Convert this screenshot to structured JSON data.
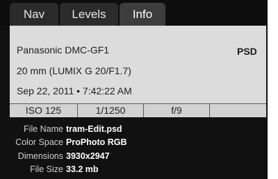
{
  "tabs": [
    {
      "label": "Nav",
      "active": false
    },
    {
      "label": "Levels",
      "active": false
    },
    {
      "label": "Info",
      "active": true
    }
  ],
  "camera": {
    "model": "Panasonic DMC-GF1",
    "lens": "20 mm (LUMIX G 20/F1.7)",
    "datetime": "Sep 22, 2011 • 7:42:22 AM",
    "format": "PSD"
  },
  "exif": {
    "iso": "ISO 125",
    "shutter": "1/1250",
    "aperture": "f/9",
    "extra": ""
  },
  "file": [
    {
      "label": "File Name",
      "value": "tram-Edit.psd"
    },
    {
      "label": "Color Space",
      "value": "ProPhoto RGB"
    },
    {
      "label": "Dimensions",
      "value": "3930x2947"
    },
    {
      "label": "File Size",
      "value": "33.2 mb"
    }
  ],
  "colors": {
    "panel_bg": "#111111",
    "active_tab_bg": "#3d3d3d",
    "tab_bg": "#2b2b2b",
    "infobox_bg": "#dcdcdc"
  }
}
